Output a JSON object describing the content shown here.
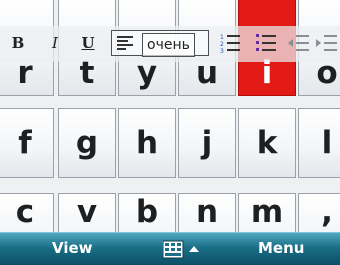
{
  "keyboard": {
    "row1": [
      "r",
      "t",
      "y",
      "u",
      "i",
      "o"
    ],
    "row2": [
      "f",
      "g",
      "h",
      "j",
      "k",
      "l"
    ],
    "row3": [
      "c",
      "v",
      "b",
      "n",
      "m",
      ","
    ],
    "pressed_key": "i",
    "pressed_color": "#e21b16"
  },
  "format_toolbar": {
    "bold": "B",
    "italic": "I",
    "underline": "U",
    "style_value": "очень"
  },
  "softkeys": {
    "left": "View",
    "right": "Menu",
    "bar_color": "#1b6f86"
  }
}
